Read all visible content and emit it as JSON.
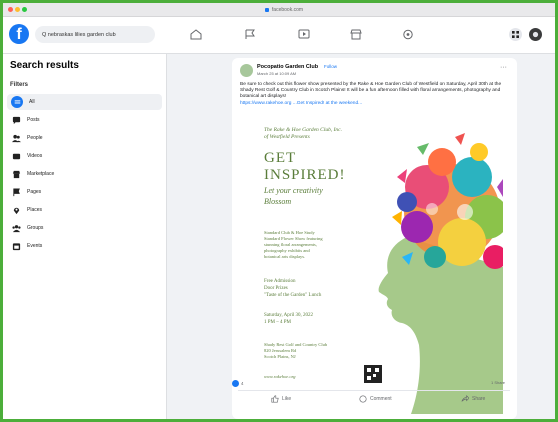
{
  "browser": {
    "url": "facebook.com"
  },
  "fb": {
    "search_text": "Q  nebraskas lilies garden club"
  },
  "sidebar": {
    "title": "Search results",
    "filters_label": "Filters",
    "items": [
      {
        "label": "All",
        "icon": "all-icon",
        "active": true
      },
      {
        "label": "Posts",
        "icon": "posts-icon"
      },
      {
        "label": "People",
        "icon": "people-icon"
      },
      {
        "label": "Videos",
        "icon": "videos-icon"
      },
      {
        "label": "Marketplace",
        "icon": "marketplace-icon"
      },
      {
        "label": "Pages",
        "icon": "pages-icon"
      },
      {
        "label": "Places",
        "icon": "places-icon"
      },
      {
        "label": "Groups",
        "icon": "groups-icon"
      },
      {
        "label": "Events",
        "icon": "events-icon"
      }
    ]
  },
  "post": {
    "author": "Pocopatio Garden Club",
    "follow": "Follow",
    "meta": "March 25 at 10:09 AM",
    "text": "Be sure to check out this flower show presented by the Rake & Hoe Garden Club of Westfield on Saturday, April 30th at the Shady Rest Golf & Country Club in Scotch Plains! It will be a fun afternoon filled with floral arrangements, photography and botanical art displays!",
    "link": "https://www.rakehoe.org ...Get Inspired! at the weekend...",
    "reactions_count": "4",
    "shares": "1 Share",
    "actions": {
      "like": "Like",
      "comment": "Comment",
      "share": "Share"
    }
  },
  "poster": {
    "org_line1": "The Rake & Hoe Garden Club, Inc.",
    "org_line2": "of Westfield Presents",
    "headline1": "GET",
    "headline2": "INSPIRED!",
    "tagline1": "Let your creativity",
    "tagline2": "Blossom",
    "desc1": "Standard Club & Hoe Study",
    "desc2": "Standard Flower Show featuring",
    "desc3": "stunning floral arrangements,",
    "desc4": "photography exhibits and",
    "desc5": "botanical arts displays.",
    "admission1": "Free Admission",
    "admission2": "Door Prizes",
    "admission3": "\"Taste of the Garden\" Lunch",
    "date1": "Saturday, April 30, 2022",
    "date2": "1 PM – 4 PM",
    "venue1": "Shady Rest Golf and Country Club",
    "venue2": "820 Jerusalem Rd",
    "venue3": "Scotch Plains, NJ",
    "site": "www.rakehoe.org"
  },
  "colors": {
    "frame": "#4cae3a",
    "fb_blue": "#1877f2",
    "poster_green": "#5a7d3a",
    "silhouette": "#a6c98a"
  }
}
